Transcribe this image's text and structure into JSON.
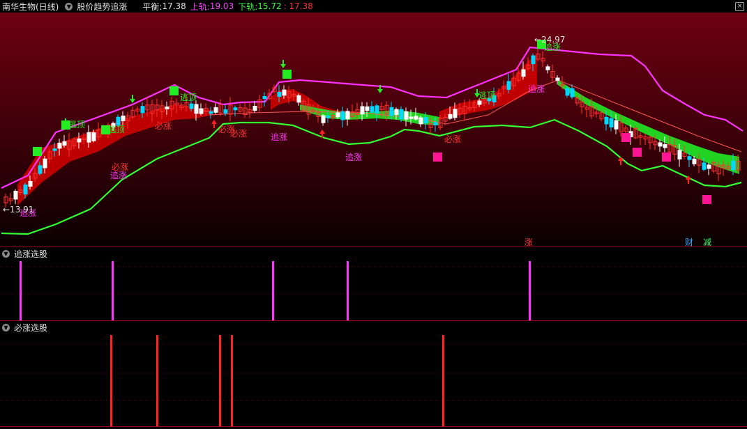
{
  "header": {
    "stock_name": "南华生物(日线)",
    "indicator_name": "股价趋势追涨",
    "balance_label": "平衡:",
    "balance_value": "17.38",
    "upper_label": "上轨:",
    "upper_value": "19.03",
    "lower_label": "下轨:",
    "lower_value": "15.72",
    "last_value": ": 17.38"
  },
  "main_chart": {
    "price_high_label": "24.97",
    "price_low_label": "13.91",
    "annotations": [
      "逃顶",
      "逃顶",
      "逃顶",
      "逃顶",
      "必涨",
      "必涨",
      "必涨",
      "必涨",
      "必涨",
      "追涨",
      "追涨",
      "追涨",
      "追涨",
      "追涨",
      "追涨"
    ],
    "bottom_markers": {
      "zhang": "涨",
      "cai": "财",
      "jian": "减"
    },
    "colors": {
      "background_top": "#6a0010",
      "upper_band": "#ff33ff",
      "lower_band": "#33ff33",
      "up_ribbon": "#cc0000",
      "down_ribbon": "#22dd22",
      "buy_marker": "#ff1493"
    }
  },
  "sub_chart_1": {
    "title": "追涨选股",
    "color": "#ff33ff"
  },
  "sub_chart_2": {
    "title": "必涨选股",
    "color": "#ff2222"
  }
}
